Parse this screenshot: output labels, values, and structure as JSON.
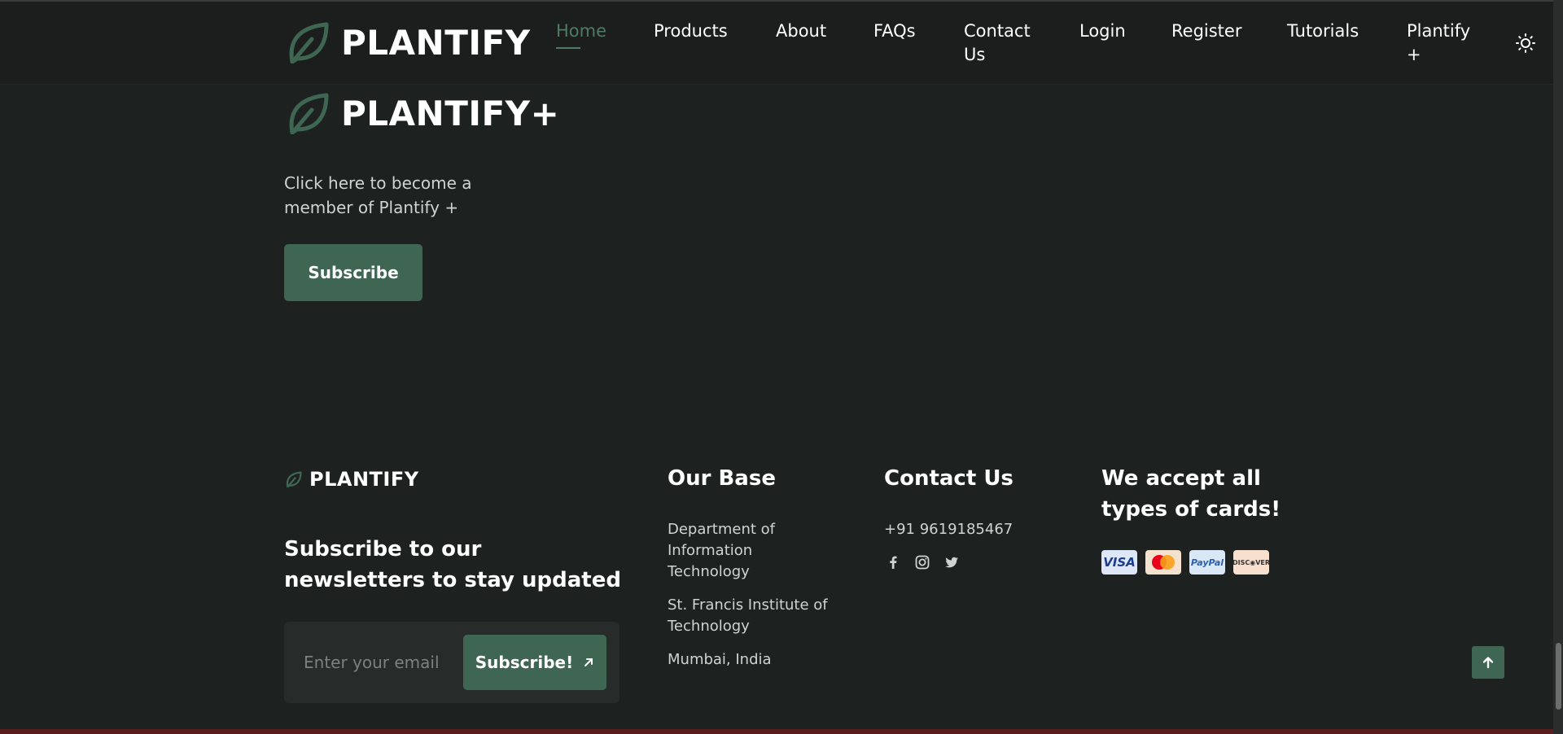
{
  "header": {
    "brand": "PLANTIFY",
    "nav": [
      {
        "label": "Home",
        "active": true
      },
      {
        "label": "Products"
      },
      {
        "label": "About"
      },
      {
        "label": "FAQs"
      },
      {
        "label": "Contact",
        "label2": "Us"
      },
      {
        "label": "Login"
      },
      {
        "label": "Register"
      },
      {
        "label": "Tutorials"
      },
      {
        "label": "Plantify",
        "label2": "+"
      }
    ],
    "theme_icon": "sun-icon"
  },
  "plus_section": {
    "brand": "PLANTIFY+",
    "description": "Click here to become a member of Plantify +",
    "button": "Subscribe"
  },
  "footer": {
    "brand": "PLANTIFY",
    "newsletter_title": "Subscribe to our newsletters to stay updated",
    "email_placeholder": "Enter your email",
    "newsletter_button": "Subscribe!",
    "base": {
      "title": "Our Base",
      "lines": [
        "Department of Information Technology",
        "St. Francis Institute of Technology",
        "Mumbai, India"
      ]
    },
    "contact": {
      "title": "Contact Us",
      "phone": "+91 9619185467",
      "social": [
        "facebook-icon",
        "instagram-icon",
        "twitter-icon"
      ]
    },
    "cards": {
      "title": "We accept all types of cards!",
      "items": [
        {
          "name": "visa",
          "label": "VISA"
        },
        {
          "name": "mastercard",
          "label": ""
        },
        {
          "name": "paypal",
          "label": "PayPal"
        },
        {
          "name": "discover",
          "label": "DISC◉VER"
        }
      ]
    }
  },
  "colors": {
    "background": "#1d2120",
    "accent": "#3e6652",
    "active_nav": "#4e7a66"
  }
}
